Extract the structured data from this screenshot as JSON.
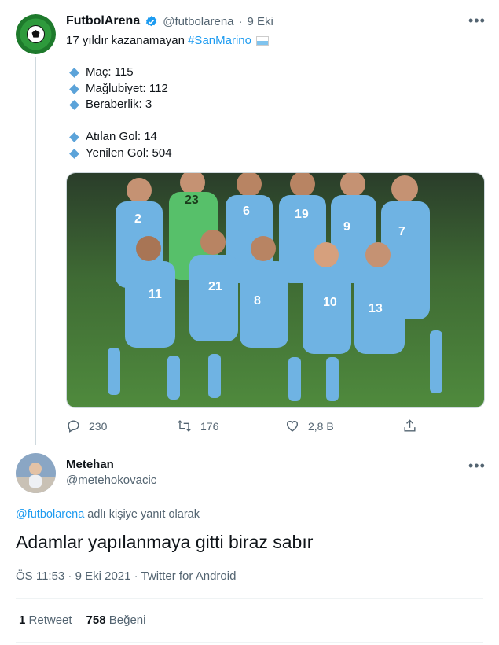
{
  "tweet": {
    "author": "FutbolArena",
    "handle": "@futbolarena",
    "separator": "·",
    "time": "9 Eki",
    "text_prefix": "17 yıldır kazanamayan ",
    "hashtag": "#SanMarino",
    "stats": [
      {
        "label": "Maç: 115"
      },
      {
        "label": "Mağlubiyet: 112"
      },
      {
        "label": "Beraberlik: 3"
      },
      {
        "label": "Atılan Gol: 14"
      },
      {
        "label": "Yenilen Gol: 504"
      }
    ],
    "actions": {
      "reply_count": "230",
      "retweet_count": "176",
      "like_count": "2,8 B"
    },
    "jersey_numbers": [
      "2",
      "23",
      "6",
      "19",
      "9",
      "7",
      "11",
      "21",
      "8",
      "10",
      "13"
    ]
  },
  "reply": {
    "author": "Metehan",
    "handle": "@metehokovacic",
    "reply_to_handle": "@futbolarena",
    "reply_to_suffix": " adlı kişiye yanıt olarak",
    "text": "Adamlar yapılanmaya gitti biraz sabır",
    "timestamp": "ÖS 11:53 · 9 Eki 2021 · Twitter for Android",
    "retweet_count": "1",
    "retweet_label": "Retweet",
    "like_count": "758",
    "like_label": "Beğeni"
  },
  "icons": {
    "verified": "verified-badge-icon",
    "more": "more-icon",
    "reply": "reply-icon",
    "retweet": "retweet-icon",
    "like": "heart-icon",
    "share": "share-icon",
    "flag": "san-marino-flag-icon"
  },
  "colors": {
    "link": "#1d9bf0",
    "bullet": "#5ba3d9",
    "muted": "#536471",
    "jersey": "#6fb3e3"
  }
}
